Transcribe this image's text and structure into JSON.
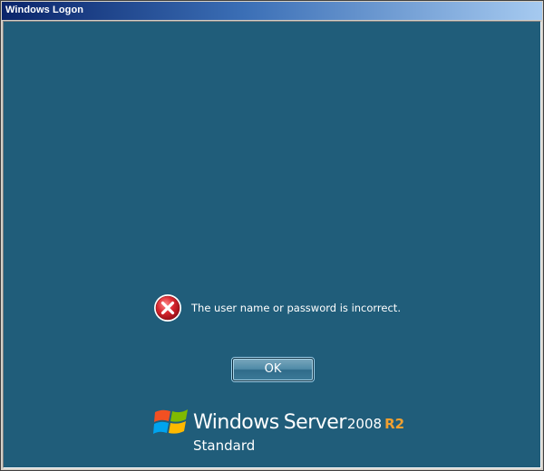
{
  "window": {
    "title": "Windows Logon"
  },
  "dialog": {
    "error_message": "The user name or password is incorrect.",
    "ok_label": "OK"
  },
  "branding": {
    "windows": "Windows",
    "server": "Server",
    "year": "2008",
    "release": "R2",
    "edition": "Standard"
  },
  "icons": {
    "error": "error-icon",
    "logo": "windows-flag-icon"
  },
  "colors": {
    "background": "#205d7a",
    "error_red": "#c8202a",
    "release_accent": "#f0a030"
  }
}
